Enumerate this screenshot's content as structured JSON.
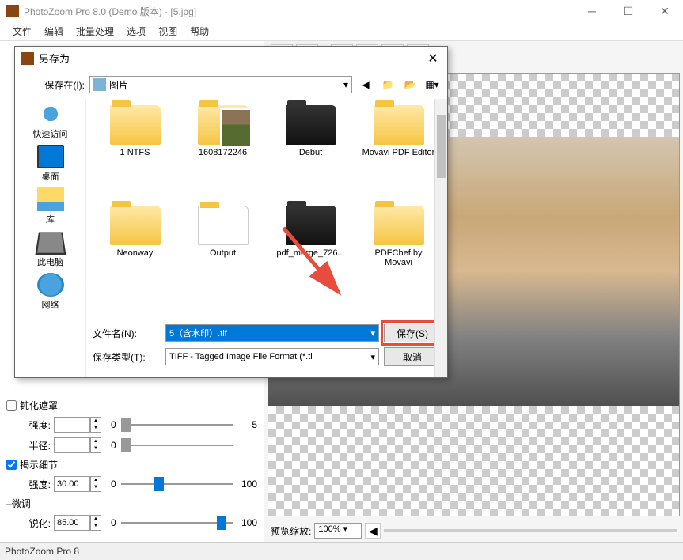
{
  "app": {
    "title": "PhotoZoom Pro 8.0 (Demo 版本) - [5.jpg]",
    "status": "PhotoZoom Pro 8"
  },
  "menu": [
    "文件",
    "编辑",
    "批量处理",
    "选项",
    "视图",
    "帮助"
  ],
  "sliders": {
    "group1": {
      "header": "钝化遮罩",
      "checked": false
    },
    "strength1": {
      "label": "强度:",
      "value": "",
      "min": "0",
      "max": "5"
    },
    "radius": {
      "label": "半径:",
      "value": "",
      "min": "0",
      "max": ""
    },
    "group2": {
      "header": "揭示细节",
      "checked": true
    },
    "strength2": {
      "label": "强度:",
      "value": "30.00",
      "min": "0",
      "max": "100"
    },
    "group3": {
      "header": "微调"
    },
    "sharp": {
      "label": "锐化:",
      "value": "85.00",
      "min": "0",
      "max": "100"
    }
  },
  "zoom": {
    "label": "预览缩放:",
    "value": "100%"
  },
  "dialog": {
    "title": "另存为",
    "savein_label": "保存在(I):",
    "savein_value": "图片",
    "places": [
      {
        "label": "快速访问",
        "cls": "star"
      },
      {
        "label": "桌面",
        "cls": "desktop"
      },
      {
        "label": "库",
        "cls": "lib"
      },
      {
        "label": "此电脑",
        "cls": "pc"
      },
      {
        "label": "网络",
        "cls": "net"
      }
    ],
    "files": [
      {
        "label": "1 NTFS",
        "cls": ""
      },
      {
        "label": "1608172246",
        "cls": "pic"
      },
      {
        "label": "Debut",
        "cls": "dark"
      },
      {
        "label": "Movavi PDF Editor",
        "cls": ""
      },
      {
        "label": "Neonway",
        "cls": ""
      },
      {
        "label": "Output",
        "cls": "white"
      },
      {
        "label": "pdf_merge_726...",
        "cls": "dark"
      },
      {
        "label": "PDFChef by Movavi",
        "cls": ""
      }
    ],
    "filename_label": "文件名(N):",
    "filename_value": "5（含水印）.tif",
    "filetype_label": "保存类型(T):",
    "filetype_value": "TIFF - Tagged Image File Format (*.ti",
    "save_btn": "保存(S)",
    "cancel_btn": "取消"
  }
}
